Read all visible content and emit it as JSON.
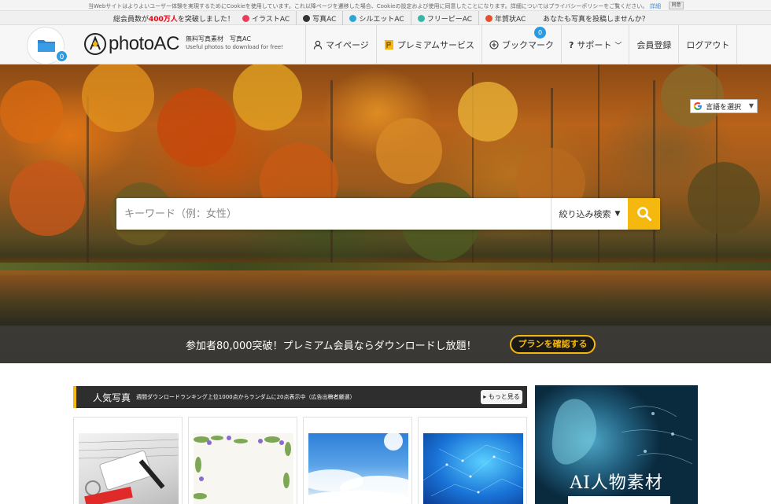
{
  "cookie": {
    "text": "当Webサイトはよりよいユーザー体験を実現するためにCookieを使用しています。これ以降ページを遷移した場合、Cookieの設定および使用に同意したことになります。詳細についてはプライバシーポリシーをご覧ください。",
    "detail": "詳細",
    "close": "同意"
  },
  "info": {
    "count_prefix": "総会員数が",
    "count_num": "400万人",
    "count_suffix": "を突破しました！",
    "sites": [
      {
        "label": "イラストAC",
        "color": "#e83e5c"
      },
      {
        "label": "写真AC",
        "color": "#333333"
      },
      {
        "label": "シルエットAC",
        "color": "#2aa6d8"
      },
      {
        "label": "フリーピーAC",
        "color": "#36b7a8"
      },
      {
        "label": "年賀状AC",
        "color": "#e84e2e"
      }
    ],
    "post_prompt": "あなたも写真を投稿しませんか？"
  },
  "header": {
    "folder_count": "0",
    "logo": "photoAC",
    "tagline_jp": "無料写真素材　写真AC",
    "tagline_en": "Useful photos to download for free!",
    "nav": {
      "mypage": "マイページ",
      "premium": "プレミアムサービス",
      "bookmark": "ブックマーク",
      "bookmark_count": "0",
      "support": "サポート",
      "register": "会員登録",
      "logout": "ログアウト"
    }
  },
  "hero": {
    "lang": "言語を選択",
    "search_placeholder": "キーワード（例：女性）",
    "filter": "絞り込み検索",
    "promo_text": "参加者80,000突破！プレミアム会員ならダウンロードし放題！",
    "promo_button": "プランを確認する"
  },
  "popular": {
    "title": "人気写真",
    "subtitle": "週間ダウンロードランキング上位1000点からランダムに20点表示中（広告出稿者厳選）",
    "more": "もっと見る",
    "thumbs": [
      "study",
      "flowers",
      "sky",
      "network"
    ]
  },
  "banner": {
    "title": "AI人物素材"
  },
  "colors": {
    "accent": "#f5b80e",
    "blue_badge": "#2a9be0",
    "dark_header": "#2e2e2e"
  }
}
